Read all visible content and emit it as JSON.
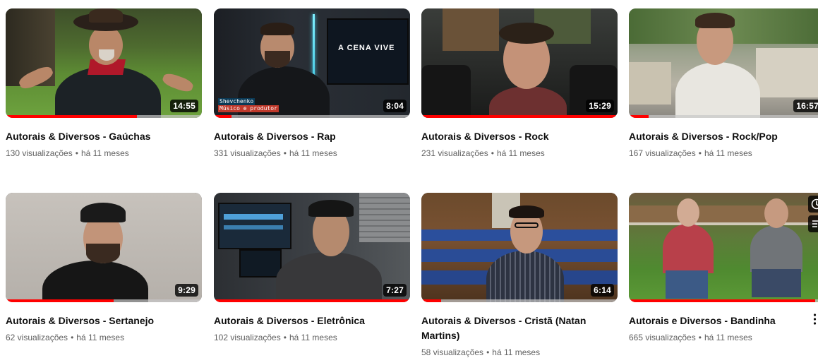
{
  "videos": [
    {
      "title": "Autorais & Diversos - Gaúchas",
      "views": "130 visualizações",
      "age": "há 11 meses",
      "duration": "14:55",
      "progress": 0.67,
      "thumbnail_icon": "video-thumbnail"
    },
    {
      "title": "Autorais & Diversos - Rap",
      "views": "331 visualizações",
      "age": "há 11 meses",
      "duration": "8:04",
      "progress": 0.09,
      "thumbnail_icon": "video-thumbnail",
      "overlay_name": "Shevchenko",
      "overlay_role": "Músico e produtor",
      "screen_text": "A CENA VIVE"
    },
    {
      "title": "Autorais & Diversos - Rock",
      "views": "231 visualizações",
      "age": "há 11 meses",
      "duration": "15:29",
      "progress": 1.0,
      "thumbnail_icon": "video-thumbnail"
    },
    {
      "title": "Autorais & Diversos - Rock/Pop",
      "views": "167 visualizações",
      "age": "há 11 meses",
      "duration": "16:57",
      "progress": 0.1,
      "thumbnail_icon": "video-thumbnail"
    },
    {
      "title": "Autorais & Diversos - Sertanejo",
      "views": "62 visualizações",
      "age": "há 11 meses",
      "duration": "9:29",
      "progress": 0.55,
      "thumbnail_icon": "video-thumbnail"
    },
    {
      "title": "Autorais & Diversos - Eletrônica",
      "views": "102 visualizações",
      "age": "há 11 meses",
      "duration": "7:27",
      "progress": 1.0,
      "thumbnail_icon": "video-thumbnail"
    },
    {
      "title": "Autorais & Diversos - Cristã (Natan Martins)",
      "views": "58 visualizações",
      "age": "há 11 meses",
      "duration": "6:14",
      "progress": 0.1,
      "thumbnail_icon": "video-thumbnail"
    },
    {
      "title": "Autorais e Diversos - Bandinha",
      "views": "665 visualizações",
      "age": "há 11 meses",
      "duration": "",
      "progress": 0.95,
      "thumbnail_icon": "video-thumbnail",
      "hover_actions": [
        "watch-later-icon",
        "add-to-queue-icon"
      ]
    }
  ],
  "meta_separator": "•",
  "colors": {
    "progress": "#ff0000",
    "title": "#0f0f0f",
    "meta": "#606060"
  }
}
